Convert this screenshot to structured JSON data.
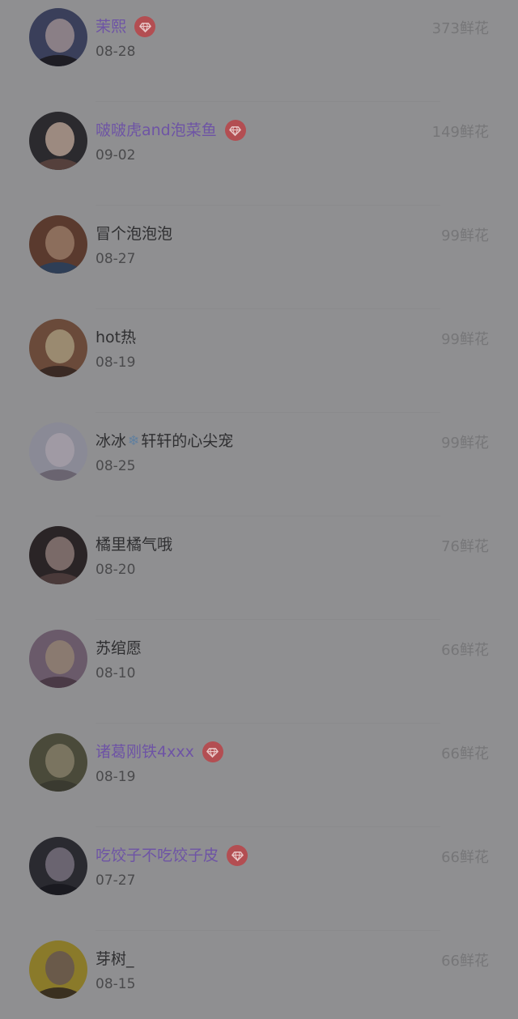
{
  "ranking_list": [
    {
      "name": "茉熙",
      "date": "08-28",
      "flowers": "373鲜花",
      "vip": true,
      "avatar_colors": [
        "#3a3f5a",
        "#8a7f86",
        "#1e1d24"
      ]
    },
    {
      "name": "啵啵虎and泡菜鱼",
      "date": "09-02",
      "flowers": "149鲜花",
      "vip": true,
      "avatar_colors": [
        "#2b2a2e",
        "#9c8a80",
        "#55403c"
      ]
    },
    {
      "name": "冒个泡泡泡",
      "date": "08-27",
      "flowers": "99鲜花",
      "vip": false,
      "avatar_colors": [
        "#5a3a2e",
        "#8c6e5c",
        "#2e3e56"
      ]
    },
    {
      "name": "hot热",
      "date": "08-19",
      "flowers": "99鲜花",
      "vip": false,
      "avatar_colors": [
        "#6a4a3a",
        "#9a8a70",
        "#3a2a24"
      ]
    },
    {
      "name": "冰冰",
      "name_icon": "❄",
      "name_suffix": "轩轩的心尖宠",
      "date": "08-25",
      "flowers": "99鲜花",
      "vip": false,
      "avatar_colors": [
        "#8a8a96",
        "#a09aa4",
        "#6a6470"
      ]
    },
    {
      "name": "橘里橘气哦",
      "date": "08-20",
      "flowers": "76鲜花",
      "vip": false,
      "avatar_colors": [
        "#2a2426",
        "#7a6a68",
        "#4a3a3a"
      ]
    },
    {
      "name": "苏绾愿",
      "date": "08-10",
      "flowers": "66鲜花",
      "vip": false,
      "avatar_colors": [
        "#6a5a6a",
        "#8a7a70",
        "#4a3a46"
      ]
    },
    {
      "name": "诸葛刚铁4xxx",
      "date": "08-19",
      "flowers": "66鲜花",
      "vip": true,
      "avatar_colors": [
        "#4a4a3a",
        "#7a7460",
        "#3a3a30"
      ]
    },
    {
      "name": "吃饺子不吃饺子皮",
      "date": "07-27",
      "flowers": "66鲜花",
      "vip": true,
      "avatar_colors": [
        "#2a2a30",
        "#6a6470",
        "#1a1a20"
      ]
    },
    {
      "name": "芽树_",
      "date": "08-15",
      "flowers": "66鲜花",
      "vip": false,
      "avatar_colors": [
        "#8a7a2a",
        "#6a5a4a",
        "#3a3020"
      ]
    }
  ],
  "vip_badge_icon": "diamond-icon",
  "colors": {
    "overlay_background": "#8f8f91",
    "vip_name": "#6e54a5",
    "vip_badge": "#b34e52",
    "normal_name": "#2f2f31"
  }
}
